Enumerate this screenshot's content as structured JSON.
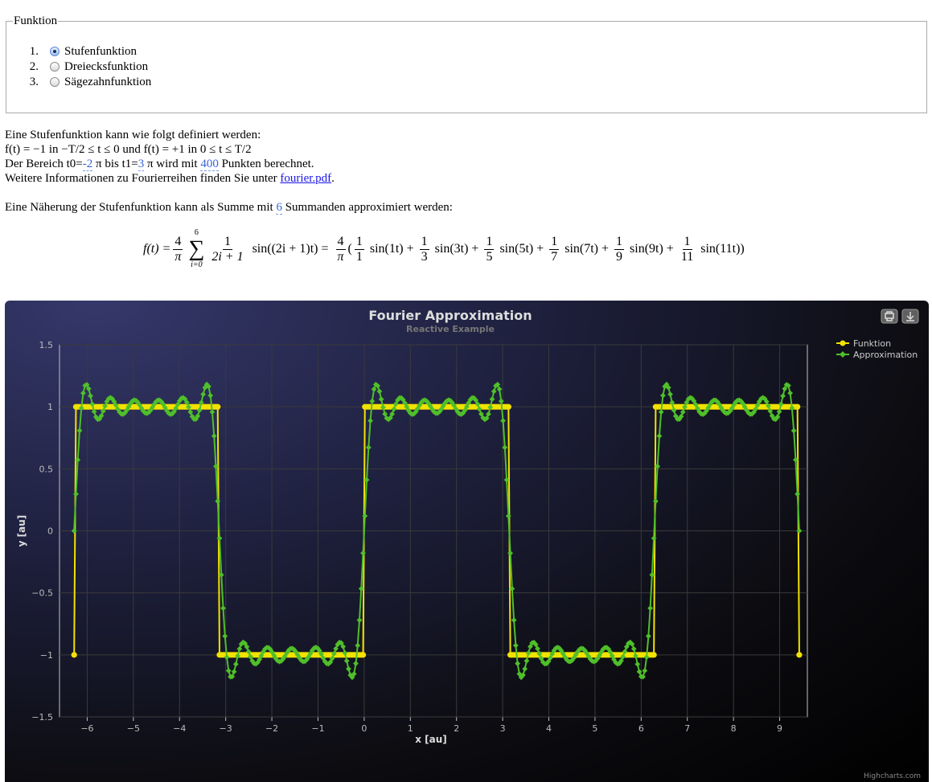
{
  "form": {
    "legend": "Funktion",
    "options": [
      {
        "num": "1.",
        "label": "Stufenfunktion",
        "checked": true
      },
      {
        "num": "2.",
        "label": "Dreiecksfunktion",
        "checked": false
      },
      {
        "num": "3.",
        "label": "Sägezahnfunktion",
        "checked": false
      }
    ]
  },
  "description": {
    "line1": "Eine Stufenfunktion kann wie folgt definiert werden:",
    "line2": "f(t) = −1 in −T/2 ≤ t ≤ 0 und f(t) = +1 in 0 ≤ t ≤ T/2",
    "line3_a": "Der Bereich t0=",
    "t0": "-2",
    "line3_b": " π bis t1=",
    "t1": "3",
    "line3_c": " π wird mit ",
    "points": "400",
    "line3_d": " Punkten berechnet.",
    "line4_a": "Weitere Informationen zu Fourierreihen finden Sie unter ",
    "link": "fourier.pdf",
    "line4_b": "."
  },
  "approx_text": {
    "a": "Eine Näherung der Stufenfunktion kann als Summe mit ",
    "n": "6",
    "b": " Summanden approximiert werden:"
  },
  "formula": {
    "lhs": "f(t) =",
    "coef_num": "4",
    "coef_den": "π",
    "sum_top": "6",
    "sum_bottom": "i=0",
    "term_num": "1",
    "term_den": "2i + 1",
    "term_fn": "sin((2i + 1)t) =",
    "paren_open": "(",
    "terms": [
      {
        "num": "1",
        "den": "1",
        "fn": "sin(1t) +"
      },
      {
        "num": "1",
        "den": "3",
        "fn": "sin(3t) +"
      },
      {
        "num": "1",
        "den": "5",
        "fn": "sin(5t) +"
      },
      {
        "num": "1",
        "den": "7",
        "fn": "sin(7t) +"
      },
      {
        "num": "1",
        "den": "9",
        "fn": "sin(9t) +"
      },
      {
        "num": "1",
        "den": "11",
        "fn": "sin(11t))"
      }
    ]
  },
  "chart_data": {
    "type": "line",
    "title": "Fourier Approximation",
    "subtitle": "Reactive Example",
    "xlabel": "x [au]",
    "ylabel": "y [au]",
    "xlim": [
      -6.6,
      9.6
    ],
    "ylim": [
      -1.5,
      1.5
    ],
    "xticks": [
      -6,
      -5,
      -4,
      -3,
      -2,
      -1,
      0,
      1,
      2,
      3,
      4,
      5,
      6,
      7,
      8,
      9
    ],
    "yticks": [
      -1.5,
      -1,
      -0.5,
      0,
      0.5,
      1,
      1.5
    ],
    "ytick_labels": [
      "−1.5",
      "−1",
      "−0.5",
      "0",
      "0.5",
      "1",
      "1.5"
    ],
    "xtick_labels": [
      "−6",
      "−5",
      "−4",
      "−3",
      "−2",
      "−1",
      "0",
      "1",
      "2",
      "3",
      "4",
      "5",
      "6",
      "7",
      "8",
      "9"
    ],
    "grid": true,
    "legend_position": "top-right",
    "credits": "Highcharts.com",
    "x_range_pi": [
      -2,
      3
    ],
    "points": 400,
    "harmonics": [
      1,
      3,
      5,
      7,
      9,
      11
    ],
    "series": [
      {
        "name": "Funktion",
        "color": "#f2e200",
        "formula": "f(x) = +1 for sin(x) > 0, −1 for sin(x) < 0",
        "x_start": -6.2832,
        "x_end": 9.4248
      },
      {
        "name": "Approximation",
        "color": "#4fbf2a",
        "formula": "4/π · Σ sin((2i+1)x)/(2i+1), i = 0..5",
        "x_start": -6.2832,
        "x_end": 9.4248
      }
    ]
  },
  "colors": {
    "funktion": "#f2e200",
    "approximation": "#4fbf2a",
    "link": "#1a16e8",
    "value": "#3a64d8"
  }
}
